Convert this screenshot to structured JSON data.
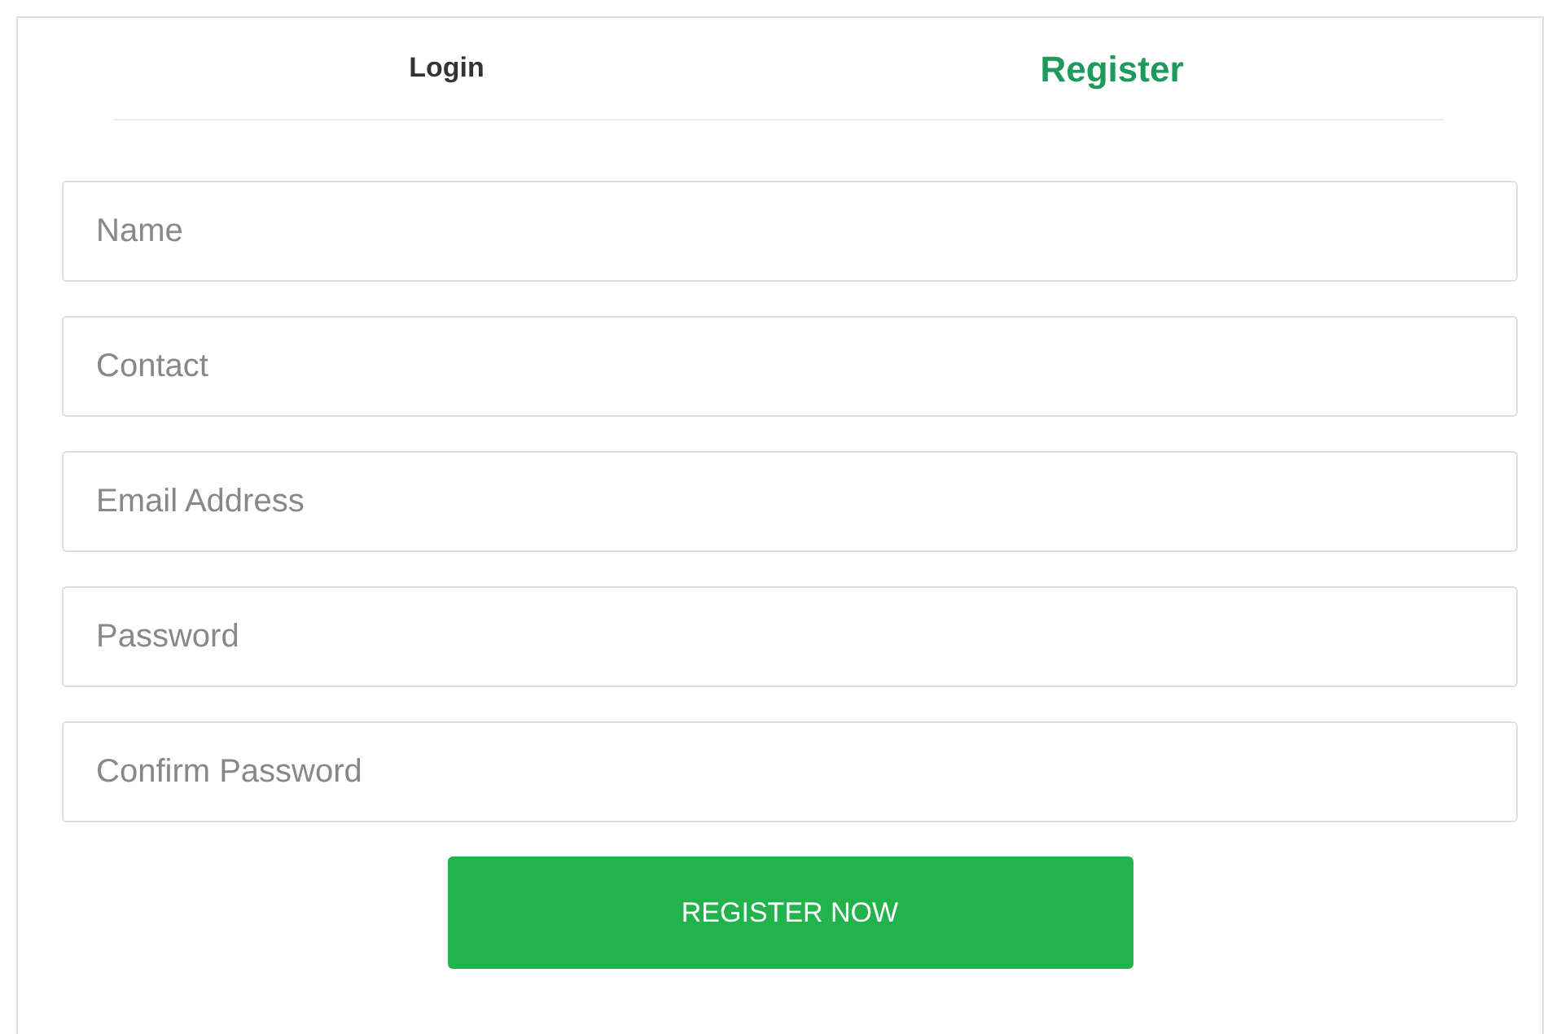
{
  "tabs": [
    {
      "label": "Login",
      "selected": false
    },
    {
      "label": "Register",
      "selected": true
    }
  ],
  "fields": [
    {
      "placeholder": "Name"
    },
    {
      "placeholder": "Contact"
    },
    {
      "placeholder": "Email Address"
    },
    {
      "placeholder": "Password"
    },
    {
      "placeholder": "Confirm Password"
    }
  ],
  "submit_button": "REGISTER NOW"
}
